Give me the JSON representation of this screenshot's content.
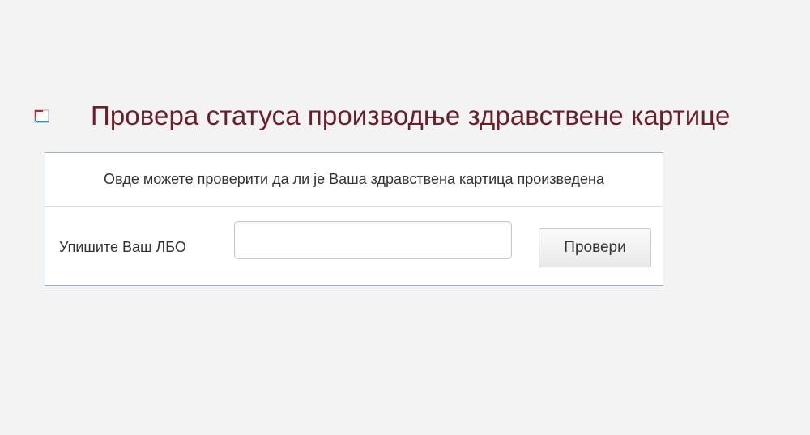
{
  "page": {
    "title": "Провера статуса производње здравствене картице",
    "title_icon": "card-icon"
  },
  "panel": {
    "info_text": "Овде можете проверити да ли је Ваша здравствена картица произведена",
    "lbo_label": "Упишите Ваш ЛБО",
    "lbo_value": "",
    "check_button_label": "Провери"
  },
  "colors": {
    "title": "#6b1f2a",
    "background": "#f3f3f3",
    "panel_border": "#9fb0bd",
    "icon_red": "#b32a2a",
    "icon_teal": "#3b8fa0"
  }
}
